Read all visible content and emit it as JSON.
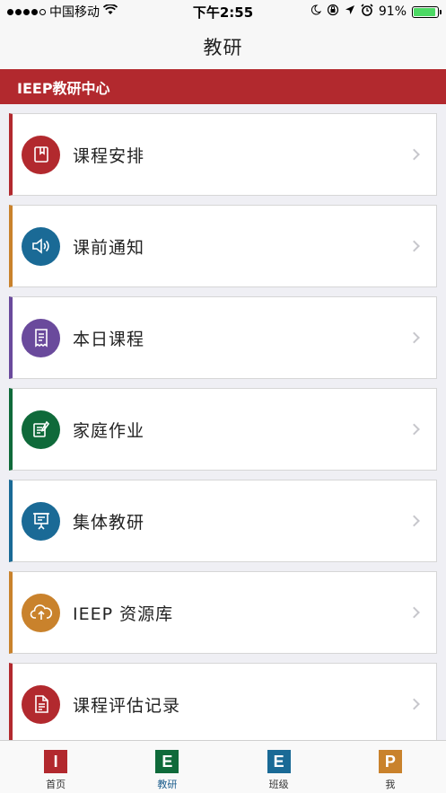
{
  "status": {
    "carrier": "中国移动",
    "time": "下午2:55",
    "battery": "91%",
    "battery_level": 0.91
  },
  "nav": {
    "title": "教研"
  },
  "section": {
    "title": "IEEP教研中心"
  },
  "colors": {
    "red": "#b2292e",
    "orange": "#c9822c",
    "purple": "#6a4a9c",
    "green": "#0f6a3a",
    "blue": "#1a6a96"
  },
  "items": [
    {
      "label": "课程安排",
      "icon": "bookmark-book-icon",
      "color": "#b2292e"
    },
    {
      "label": "课前通知",
      "icon": "speaker-icon",
      "color": "#1a6a96",
      "border": "#c9822c"
    },
    {
      "label": "本日课程",
      "icon": "receipt-icon",
      "color": "#6a4a9c"
    },
    {
      "label": "家庭作业",
      "icon": "notebook-pen-icon",
      "color": "#0f6a3a"
    },
    {
      "label": "集体教研",
      "icon": "presentation-board-icon",
      "color": "#1a6a96"
    },
    {
      "label": "IEEP 资源库",
      "icon": "cloud-upload-icon",
      "color": "#c9822c"
    },
    {
      "label": "课程评估记录",
      "icon": "document-icon",
      "color": "#b2292e"
    }
  ],
  "tabs": [
    {
      "label": "首页",
      "letter": "I",
      "color": "#b2292e"
    },
    {
      "label": "教研",
      "letter": "E",
      "color": "#0f6a3a",
      "active": true
    },
    {
      "label": "班级",
      "letter": "E",
      "color": "#1a6a96"
    },
    {
      "label": "我",
      "letter": "P",
      "color": "#c9822c"
    }
  ]
}
